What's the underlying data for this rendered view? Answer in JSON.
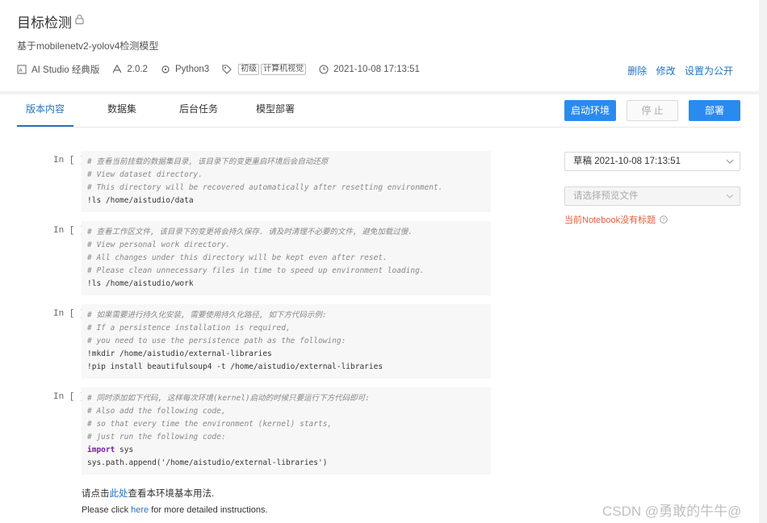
{
  "header": {
    "title": "目标检测",
    "subtitle": "基于mobilenetv2-yolov4检测模型",
    "meta": {
      "platform": "AI Studio 经典版",
      "framework_version": "2.0.2",
      "language": "Python3",
      "tags": [
        "初级",
        "计算机视觉"
      ],
      "datetime": "2021-10-08 17:13:51"
    },
    "actions": {
      "delete": "删除",
      "edit": "修改",
      "make_public": "设置为公开"
    }
  },
  "tabs": [
    {
      "label": "版本内容",
      "active": true
    },
    {
      "label": "数据集",
      "active": false
    },
    {
      "label": "后台任务",
      "active": false
    },
    {
      "label": "模型部署",
      "active": false
    }
  ],
  "buttons": {
    "start": "启动环境",
    "stop": "停 止",
    "deploy": "部署"
  },
  "cells": [
    {
      "prompt": "In [ ]",
      "lines": [
        {
          "t": "# 查看当前挂载的数据集目录, 该目录下的变更重启环境后会自动还原",
          "k": "c"
        },
        {
          "t": "# View dataset directory.",
          "k": "c"
        },
        {
          "t": "# This directory will be recovered automatically after resetting environment.",
          "k": "c"
        },
        {
          "t": "!ls /home/aistudio/data",
          "k": "l"
        }
      ]
    },
    {
      "prompt": "In [ ]",
      "lines": [
        {
          "t": "# 查看工作区文件, 该目录下的变更将会持久保存. 请及时清理不必要的文件, 避免加载过慢.",
          "k": "c"
        },
        {
          "t": "# View personal work directory.",
          "k": "c"
        },
        {
          "t": "# All changes under this directory will be kept even after reset.",
          "k": "c"
        },
        {
          "t": "# Please clean unnecessary files in time to speed up environment loading.",
          "k": "c"
        },
        {
          "t": "!ls /home/aistudio/work",
          "k": "l"
        }
      ]
    },
    {
      "prompt": "In [ ]",
      "lines": [
        {
          "t": "# 如果需要进行持久化安装, 需要使用持久化路径, 如下方代码示例:",
          "k": "c"
        },
        {
          "t": "# If a persistence installation is required,",
          "k": "c"
        },
        {
          "t": "# you need to use the persistence path as the following:",
          "k": "c"
        },
        {
          "t": "!mkdir /home/aistudio/external-libraries",
          "k": "l"
        },
        {
          "t": "!pip install beautifulsoup4 -t /home/aistudio/external-libraries",
          "k": "l"
        }
      ]
    },
    {
      "prompt": "In [ ]",
      "lines": [
        {
          "t": "# 同时添加如下代码, 这样每次环境(kernel)启动的时候只要运行下方代码即可:",
          "k": "c"
        },
        {
          "t": "# Also add the following code,",
          "k": "c"
        },
        {
          "t": "# so that every time the environment (kernel) starts,",
          "k": "c"
        },
        {
          "t": "# just run the following code:",
          "k": "c"
        },
        {
          "t": "import",
          "k": "kw",
          "rest": " sys"
        },
        {
          "t": "sys.path.append('/home/aistudio/external-libraries')",
          "k": "l"
        }
      ]
    }
  ],
  "notes": {
    "zh_before": "请点击",
    "zh_link": "此处",
    "zh_after": "查看本环境基本用法.",
    "en_before": "Please click ",
    "en_link": "here",
    "en_after": " for more detailed instructions."
  },
  "sidebar": {
    "version_select": "草稿 2021-10-08 17:13:51",
    "preview_placeholder": "请选择预览文件",
    "warning": "当前Notebook没有标题"
  },
  "watermark": "CSDN @勇敢的牛牛@"
}
